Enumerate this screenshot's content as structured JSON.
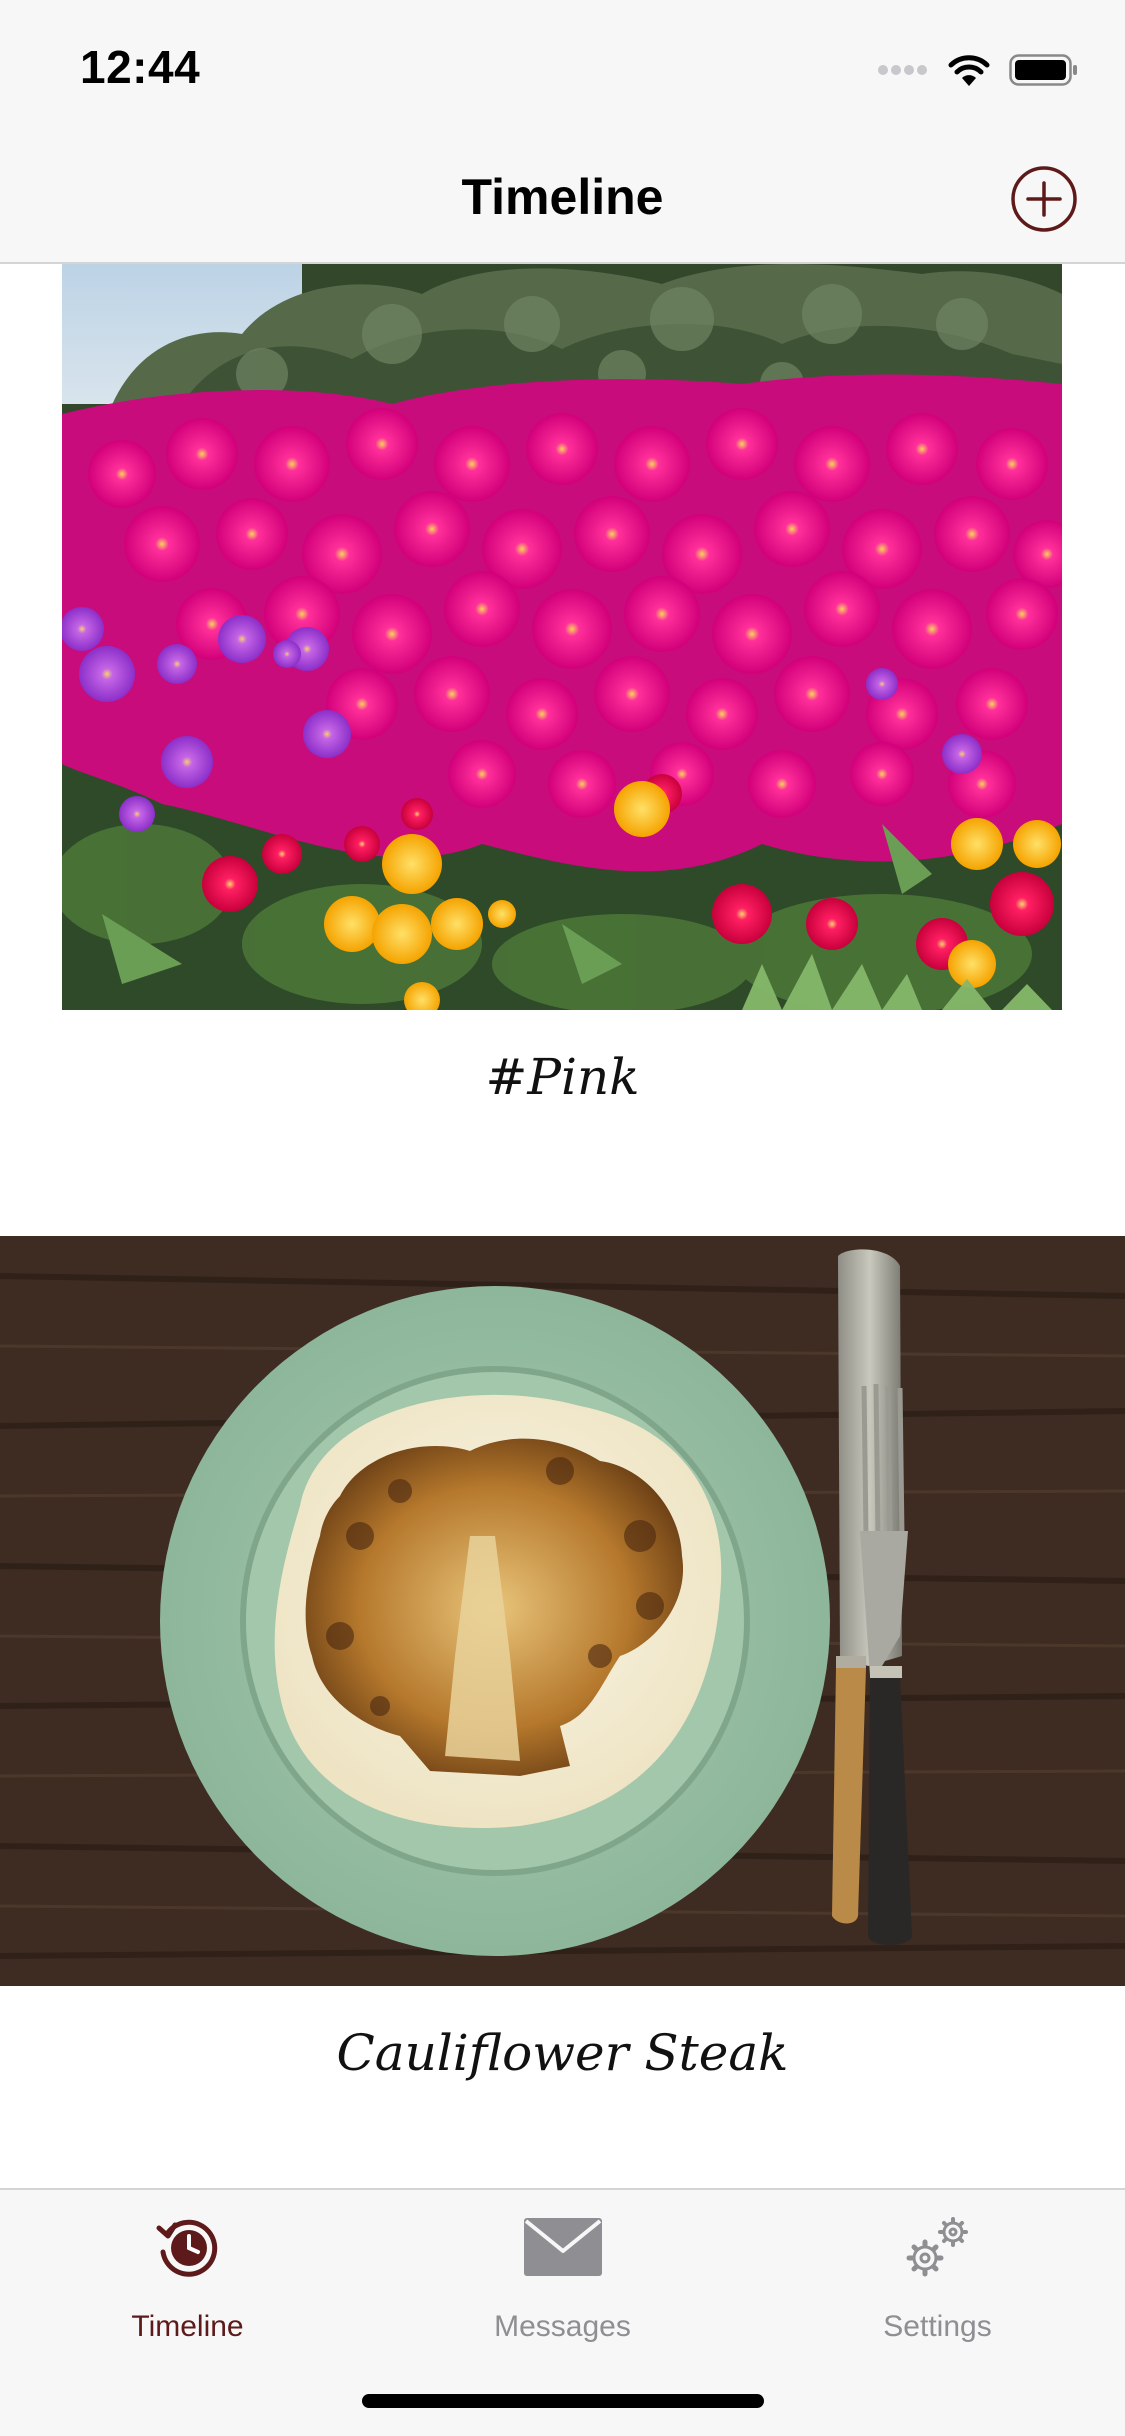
{
  "status_bar": {
    "time": "12:44"
  },
  "nav": {
    "title": "Timeline",
    "add_icon": "plus-circle-icon"
  },
  "posts": [
    {
      "caption": "#Pink",
      "image": "pink-flowers-photo"
    },
    {
      "caption": "Cauliflower Steak",
      "image": "cauliflower-steak-photo"
    }
  ],
  "tabs": [
    {
      "label": "Timeline",
      "icon": "clock-history-icon",
      "selected": true
    },
    {
      "label": "Messages",
      "icon": "envelope-icon",
      "selected": false
    },
    {
      "label": "Settings",
      "icon": "gears-icon",
      "selected": false
    }
  ],
  "colors": {
    "accent": "#5e1a1a",
    "inactive": "#8e8e93",
    "bar_background": "#f7f7f7"
  }
}
